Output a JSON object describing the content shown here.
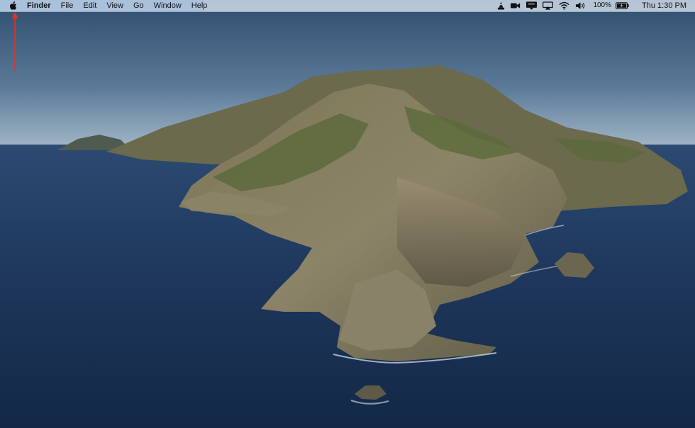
{
  "menubar": {
    "apple_icon": "apple-logo-icon",
    "app_name": "Finder",
    "menus": [
      "File",
      "Edit",
      "View",
      "Go",
      "Window",
      "Help"
    ],
    "status": {
      "icons": [
        "vlc-cone-icon",
        "facetime-camera-icon",
        "notification-icon",
        "airplay-icon",
        "wifi-icon",
        "volume-icon"
      ],
      "battery_percent": "100%",
      "battery_icon": "battery-charging-icon",
      "clock": "Thu 1:30 PM"
    }
  },
  "annotation": {
    "arrow_color": "#e0322b",
    "arrow_target": "apple-menu"
  },
  "desktop": {
    "wallpaper": "island-coastline"
  }
}
